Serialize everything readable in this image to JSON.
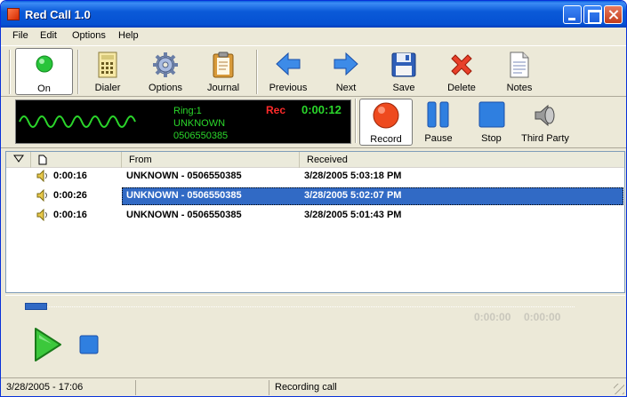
{
  "window": {
    "title": "Red Call 1.0"
  },
  "menu": [
    "File",
    "Edit",
    "Options",
    "Help"
  ],
  "toolbar": {
    "on": "On",
    "dialer": "Dialer",
    "options": "Options",
    "journal": "Journal",
    "previous": "Previous",
    "next": "Next",
    "save": "Save",
    "delete": "Delete",
    "notes": "Notes"
  },
  "display": {
    "ring": "Ring:1",
    "caller": "UNKNOWN",
    "number": "0506550385",
    "rec_label": "Rec",
    "rec_time": "0:00:12"
  },
  "controls": {
    "record": "Record",
    "pause": "Pause",
    "stop": "Stop",
    "third_party": "Third Party"
  },
  "list": {
    "columns": [
      "",
      "",
      "From",
      "Received"
    ],
    "rows": [
      {
        "duration": "0:00:16",
        "from": "UNKNOWN - 0506550385",
        "received": "3/28/2005 5:03:18 PM",
        "selected": false
      },
      {
        "duration": "0:00:26",
        "from": "UNKNOWN - 0506550385",
        "received": "3/28/2005 5:02:07 PM",
        "selected": true
      },
      {
        "duration": "0:00:16",
        "from": "UNKNOWN - 0506550385",
        "received": "3/28/2005 5:01:43 PM",
        "selected": false
      }
    ]
  },
  "player": {
    "elapsed": "0:00:00",
    "total": "0:00:00",
    "progress": 0.04
  },
  "status": {
    "datetime": "3/28/2005 - 17:06",
    "panel2": "",
    "message": "Recording call"
  }
}
